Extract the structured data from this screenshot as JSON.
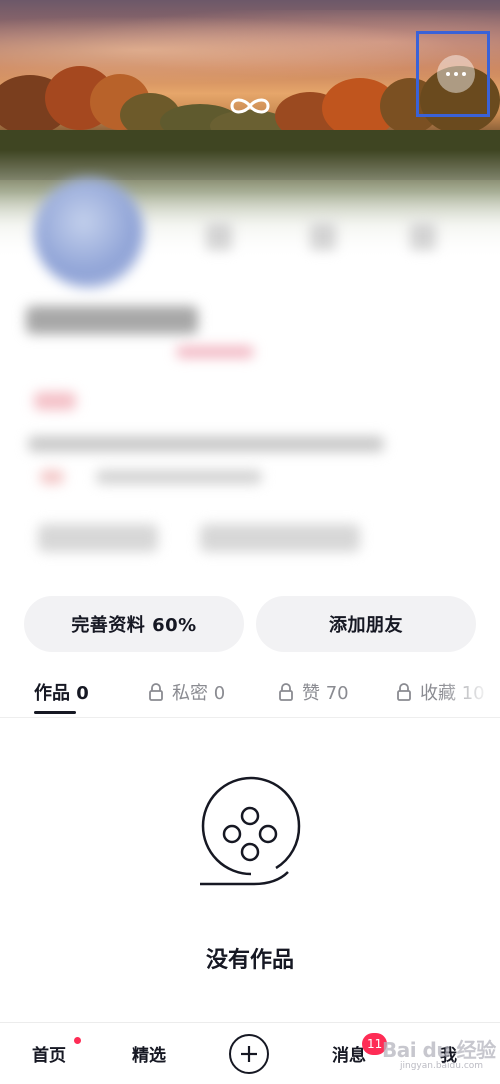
{
  "profile": {
    "complete_button": "完善资料 60%",
    "add_friends_button": "添加朋友"
  },
  "tabs": [
    {
      "label": "作品 0",
      "locked": false,
      "active": true
    },
    {
      "label": "私密 0",
      "locked": true,
      "active": false
    },
    {
      "label": "赞 70",
      "locked": true,
      "active": false
    },
    {
      "label": "收藏 10",
      "locked": true,
      "active": false
    }
  ],
  "empty_state": {
    "message": "没有作品",
    "icon": "film-reel-icon"
  },
  "bottom_nav": {
    "home": "首页",
    "featured": "精选",
    "messages": "消息",
    "messages_badge": "11",
    "me": "我"
  },
  "watermark": {
    "brand": "Bai du 经验",
    "url": "jingyan.baidu.com"
  },
  "colors": {
    "accent": "#fe2c55",
    "highlight_box": "#3a62d8",
    "text_primary": "#161823",
    "text_secondary": "#8a8b91",
    "button_bg": "#f2f2f4"
  }
}
